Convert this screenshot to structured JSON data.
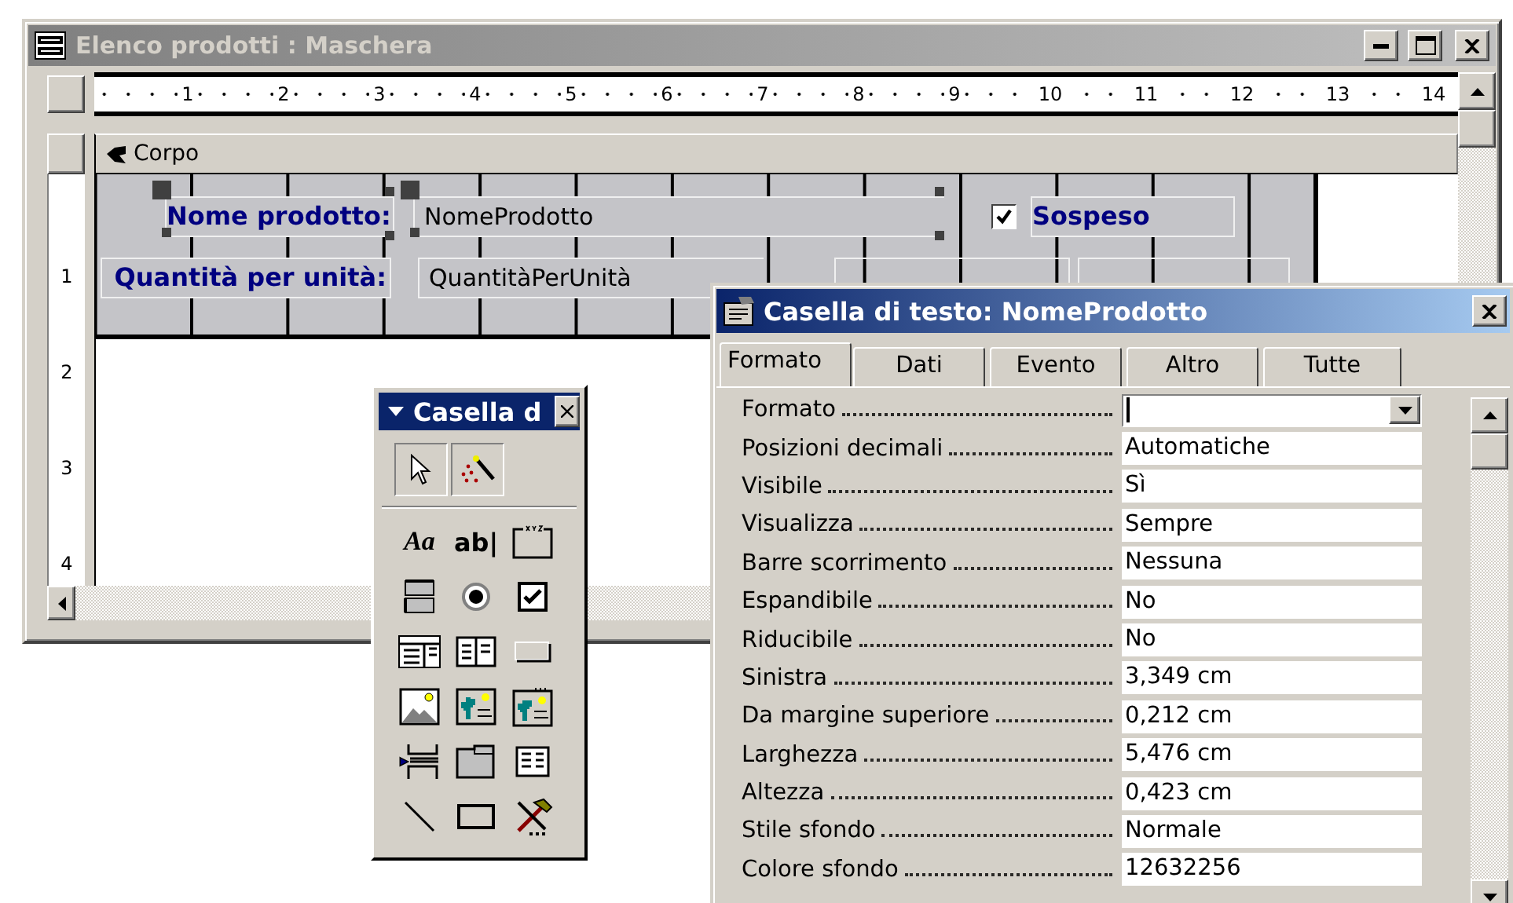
{
  "main_window": {
    "title": "Elenco prodotti : Maschera",
    "ruler_marks": [
      "1",
      "2",
      "3",
      "4",
      "5",
      "6",
      "7",
      "8",
      "9",
      "10",
      "11",
      "12",
      "13",
      "14"
    ],
    "vertical_ruler_marks": [
      "1",
      "2",
      "3",
      "4"
    ],
    "section": {
      "label": "Corpo"
    },
    "controls": [
      {
        "kind": "label",
        "text": "Nome prodotto:",
        "selected": true
      },
      {
        "kind": "textbox",
        "text": "NomeProdotto",
        "selected": true
      },
      {
        "kind": "checkbox",
        "checked": true
      },
      {
        "kind": "label",
        "text": "Sospeso",
        "selected": false
      },
      {
        "kind": "label",
        "text": "Quantità per unità:",
        "selected": false
      },
      {
        "kind": "textbox",
        "text": "QuantitàPerUnità",
        "selected": false
      }
    ]
  },
  "toolbox": {
    "title": "Casella d",
    "top_tools": [
      {
        "kind": "pointer",
        "pressed": true
      },
      {
        "kind": "wizard",
        "pressed": true
      }
    ],
    "tools": [
      {
        "kind": "label",
        "text": "Aa"
      },
      {
        "kind": "textbox",
        "text": "ab|"
      },
      {
        "kind": "option_group"
      },
      {
        "kind": "toggle"
      },
      {
        "kind": "radio"
      },
      {
        "kind": "checkbox"
      },
      {
        "kind": "combo"
      },
      {
        "kind": "listbox"
      },
      {
        "kind": "command"
      },
      {
        "kind": "image"
      },
      {
        "kind": "unbound_frame"
      },
      {
        "kind": "bound_frame"
      },
      {
        "kind": "page_break"
      },
      {
        "kind": "tab_control"
      },
      {
        "kind": "subform"
      },
      {
        "kind": "line"
      },
      {
        "kind": "rectangle"
      },
      {
        "kind": "more"
      }
    ]
  },
  "properties": {
    "title": "Casella di testo: NomeProdotto",
    "tabs": [
      {
        "label": "Formato",
        "selected": true
      },
      {
        "label": "Dati",
        "selected": false
      },
      {
        "label": "Evento",
        "selected": false
      },
      {
        "label": "Altro",
        "selected": false
      },
      {
        "label": "Tutte",
        "selected": false
      }
    ],
    "rows": [
      {
        "kind": "combo",
        "label": "Formato"
      },
      {
        "kind": "text",
        "label": "Posizioni decimali",
        "value": "Automatiche"
      },
      {
        "kind": "text",
        "label": "Visibile",
        "value": "Sì"
      },
      {
        "kind": "text",
        "label": "Visualizza",
        "value": "Sempre"
      },
      {
        "kind": "text",
        "label": "Barre scorrimento",
        "value": "Nessuna"
      },
      {
        "kind": "text",
        "label": "Espandibile",
        "value": "No"
      },
      {
        "kind": "text",
        "label": "Riducibile",
        "value": "No"
      },
      {
        "kind": "text",
        "label": "Sinistra",
        "value": "3,349 cm"
      },
      {
        "kind": "text",
        "label": "Da margine superiore",
        "value": "0,212 cm"
      },
      {
        "kind": "text",
        "label": "Larghezza",
        "value": "5,476 cm"
      },
      {
        "kind": "text",
        "label": "Altezza",
        "value": "0,423 cm"
      },
      {
        "kind": "text",
        "label": "Stile sfondo",
        "value": "Normale"
      },
      {
        "kind": "text",
        "label": "Colore sfondo",
        "value": "12632256"
      }
    ]
  }
}
